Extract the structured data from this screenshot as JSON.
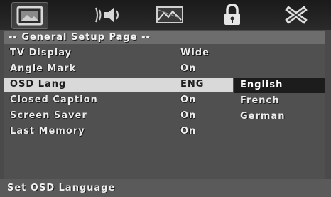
{
  "tabs": [
    {
      "icon": "general-setup-icon"
    },
    {
      "icon": "audio-setup-icon"
    },
    {
      "icon": "video-setup-icon"
    },
    {
      "icon": "password-lock-icon"
    },
    {
      "icon": "exit-icon"
    }
  ],
  "page_title": "-- General Setup Page --",
  "menu": {
    "items": [
      {
        "label": "TV Display",
        "value": "Wide"
      },
      {
        "label": "Angle Mark",
        "value": "On"
      },
      {
        "label": "OSD Lang",
        "value": "ENG"
      },
      {
        "label": "Closed Caption",
        "value": "On"
      },
      {
        "label": "Screen Saver",
        "value": "On"
      },
      {
        "label": "Last Memory",
        "value": "On"
      }
    ],
    "selected_index": 2
  },
  "options": {
    "items": [
      "English",
      "French",
      "German"
    ],
    "selected_index": 0
  },
  "status": {
    "text": "Set OSD Language"
  }
}
